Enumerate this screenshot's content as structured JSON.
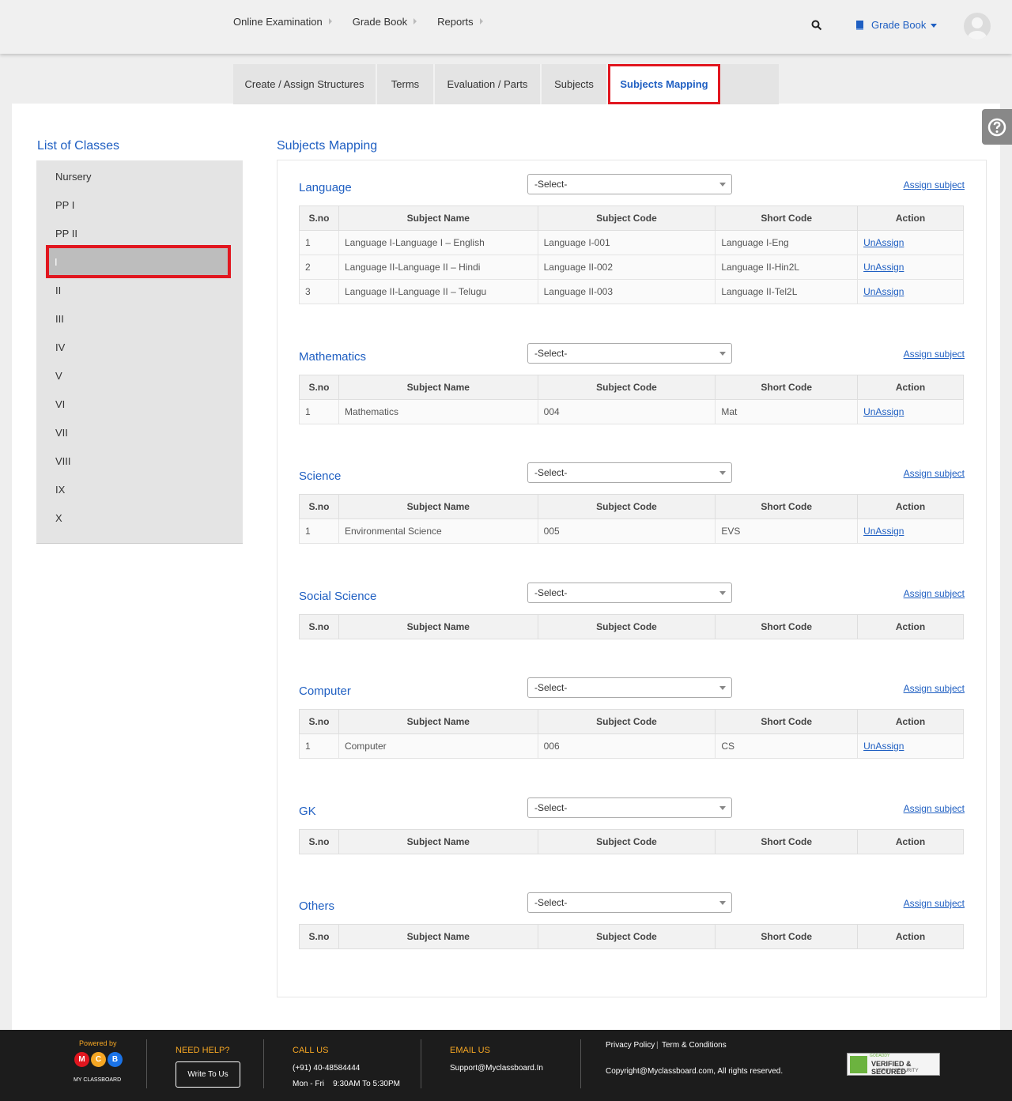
{
  "topnav": {
    "items": [
      "Online Examination",
      "Grade Book",
      "Reports"
    ],
    "module_label": "Grade Book"
  },
  "tabs": [
    "Create / Assign Structures",
    "Terms",
    "Evaluation / Parts",
    "Subjects",
    "Subjects Mapping"
  ],
  "sidebar": {
    "title": "List of Classes",
    "classes": [
      "Nursery",
      "PP I",
      "PP II",
      "I",
      "II",
      "III",
      "IV",
      "V",
      "VI",
      "VII",
      "VIII",
      "IX",
      "X"
    ],
    "selected": "I"
  },
  "mapping": {
    "title": "Subjects Mapping",
    "select_placeholder": "-Select-",
    "assign_label": "Assign subject",
    "unassign_label": "UnAssign",
    "columns": [
      "S.no",
      "Subject Name",
      "Subject Code",
      "Short Code",
      "Action"
    ],
    "sections": [
      {
        "name": "Language",
        "rows": [
          [
            "1",
            "Language I-Language I – English",
            "Language I-001",
            "Language I-Eng"
          ],
          [
            "2",
            "Language II-Language II – Hindi",
            "Language II-002",
            "Language II-Hin2L"
          ],
          [
            "3",
            "Language II-Language II – Telugu",
            "Language II-003",
            "Language II-Tel2L"
          ]
        ]
      },
      {
        "name": "Mathematics",
        "rows": [
          [
            "1",
            "Mathematics",
            "004",
            "Mat"
          ]
        ]
      },
      {
        "name": "Science",
        "rows": [
          [
            "1",
            "Environmental Science",
            "005",
            "EVS"
          ]
        ]
      },
      {
        "name": "Social Science",
        "rows": []
      },
      {
        "name": "Computer",
        "rows": [
          [
            "1",
            "Computer",
            "006",
            "CS"
          ]
        ]
      },
      {
        "name": "GK",
        "rows": []
      },
      {
        "name": "Others",
        "rows": []
      }
    ]
  },
  "footer": {
    "powered_by": "Powered by",
    "logo_letters": [
      "M",
      "C",
      "B"
    ],
    "logo_sub": "MY CLASSBOARD",
    "need_help": "NEED HELP?",
    "write_to_us": "Write To Us",
    "call_us": "CALL US",
    "phone": "(+91) 40-48584444",
    "hours": "Mon - Fri    9:30AM To 5:30PM",
    "email_us": "EMAIL US",
    "email": "Support@Myclassboard.In",
    "privacy": "Privacy Policy",
    "terms": "Term & Conditions",
    "copyright": "Copyright@Myclassboard.com, All rights reserved.",
    "seal_line1": "GODADDY",
    "seal_line2": "VERIFIED & SECURED",
    "seal_line3": "VERIFY SECURITY"
  },
  "colors": {
    "accent": "#1f5fc2",
    "highlight": "#e1161f",
    "footer_accent": "#f5a623",
    "logo_m": "#e1161f",
    "logo_c": "#f5a623",
    "logo_b": "#1a73e8"
  }
}
